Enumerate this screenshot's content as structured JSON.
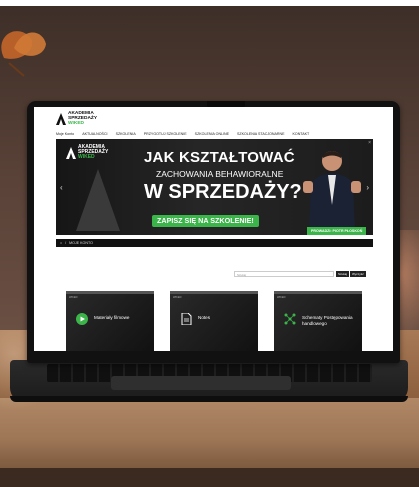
{
  "site": {
    "logo_line1": "AKADEMIA",
    "logo_line2": "SPRZEDAŻY",
    "logo_line3": "WIKED",
    "login": "Moje Konto",
    "nav": [
      "AKTUALNOŚCI",
      "SZKOLENIA",
      "PRZYGOTUJ SZKOLENIE",
      "SZKOLENIA ONLINE",
      "SZKOLENIA STACJONARNE",
      "KONTAKT"
    ]
  },
  "banner": {
    "headline": "JAK KSZTAŁTOWAĆ",
    "subheadline": "ZACHOWANIA BEHAWIORALNE",
    "headline2": "W SPRZEDAŻY?",
    "cta": "ZAPISZ SIĘ NA SZKOLENIE!",
    "presenter": "PROWADZI: PIOTR PŁOSKOŃ"
  },
  "breadcrumb": {
    "home": "⌂",
    "sep": "/",
    "current": "MOJE KONTO"
  },
  "search": {
    "placeholder": "Szukaj",
    "btn1": "Szukaj",
    "btn2": "Wyczyść"
  },
  "cards": [
    {
      "label": "Materiały filmowe",
      "icon": "play-icon"
    },
    {
      "label": "Notes",
      "icon": "document-icon"
    },
    {
      "label": "Schematy Postępowania handlowego",
      "icon": "network-icon"
    }
  ],
  "colors": {
    "accent": "#3bb54a",
    "banner_bg": "#1c1c1c"
  }
}
